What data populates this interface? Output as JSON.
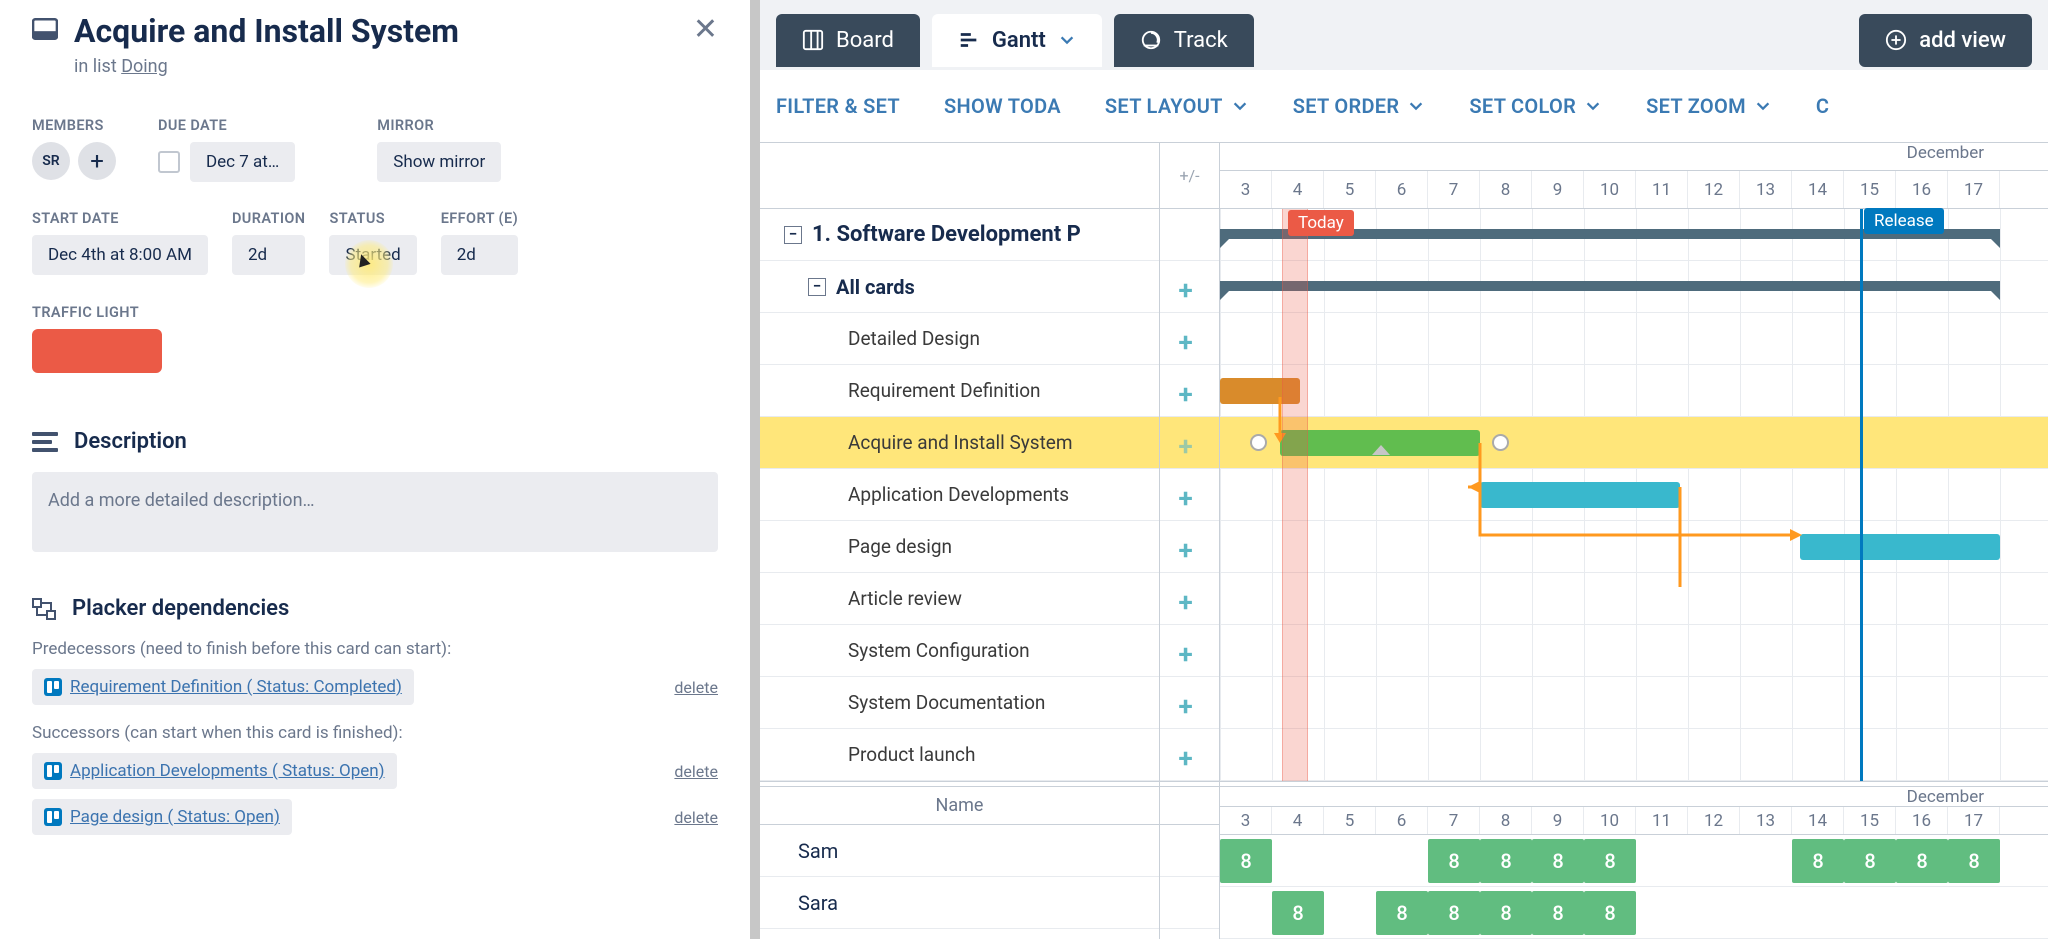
{
  "card": {
    "title": "Acquire and Install System",
    "in_list_prefix": "in list ",
    "in_list": "Doing",
    "close_glyph": "✕",
    "members_label": "MEMBERS",
    "member_initials": "SR",
    "member_add_glyph": "+",
    "due_label": "DUE DATE",
    "due_value": "Dec 7 at…",
    "mirror_label": "MIRROR",
    "mirror_value": "Show mirror",
    "start_label": "START DATE",
    "start_value": "Dec 4th at 8:00 AM",
    "duration_label": "DURATION",
    "duration_value": "2d",
    "status_label": "STATUS",
    "status_value": "Started",
    "effort_label": "EFFORT (E)",
    "effort_value": "2d",
    "traffic_label": "TRAFFIC LIGHT",
    "traffic_color": "#eb5a46",
    "description_title": "Description",
    "description_placeholder": "Add a more detailed description…",
    "deps_title": "Placker dependencies",
    "predecessors_label": "Predecessors (need to finish before this card can start):",
    "successors_label": "Successors (can start when this card is finished):",
    "predecessors": [
      {
        "text": "Requirement Definition ( Status: Completed)",
        "delete": "delete"
      }
    ],
    "successors": [
      {
        "text": "Application Developments ( Status: Open)",
        "delete": "delete"
      },
      {
        "text": "Page design ( Status: Open)",
        "delete": "delete"
      }
    ]
  },
  "tabs": {
    "board": "Board",
    "gantt": "Gantt",
    "track": "Track",
    "add_view": "add view"
  },
  "toolbar": {
    "filter": "FILTER & SET",
    "today": "SHOW TODA",
    "layout": "SET LAYOUT",
    "order": "SET ORDER",
    "color": "SET COLOR",
    "zoom": "SET ZOOM",
    "last": "C"
  },
  "gantt": {
    "plus_minus": "+/-",
    "month": "December",
    "today_label": "Today",
    "release_label": "Release",
    "days": [
      3,
      4,
      5,
      6,
      7,
      8,
      9,
      10,
      11,
      12,
      13,
      14,
      15,
      16,
      17
    ],
    "group_label": "1. Software Development P",
    "allcards_label": "All cards",
    "tasks": [
      "Detailed Design",
      "Requirement Definition",
      "Acquire and Install System",
      "Application Developments",
      "Page design",
      "Article review",
      "System Configuration",
      "System Documentation",
      "Product launch"
    ],
    "name_header": "Name",
    "people": [
      "Sam",
      "Sara"
    ]
  },
  "resource": {
    "sam": {
      "cells": [
        3,
        7,
        8,
        9,
        10,
        14,
        15,
        16,
        17
      ],
      "value": "8"
    },
    "sara": {
      "cells": [
        4,
        6,
        7,
        8,
        9,
        10
      ],
      "value": "8"
    }
  }
}
